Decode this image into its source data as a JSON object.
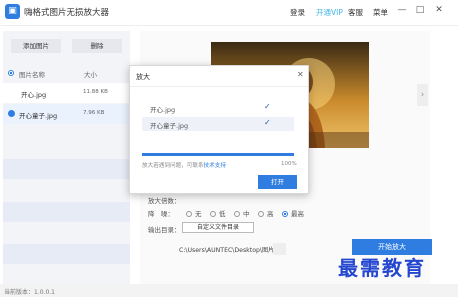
{
  "app": {
    "title": "嗨格式图片无损放大器",
    "logo_glyph": "▣"
  },
  "header": {
    "login": "登录",
    "vip": "开通VIP",
    "service": "客服",
    "menu": "菜单",
    "vip_color": "#3fb5e8"
  },
  "window": {
    "minimize": "—",
    "maximize": "□",
    "close": "✕"
  },
  "sidebar": {
    "add_button": "添加图片",
    "delete_button": "删除",
    "col_name": "图片名称",
    "col_size": "大小",
    "files": [
      {
        "name": "开心.jpg",
        "size": "11.88 KB",
        "selected": false
      },
      {
        "name": "开心童子.jpg",
        "size": "7.96 KB",
        "selected": true
      }
    ]
  },
  "settings": {
    "scale_label": "放大倍数：",
    "denoise_label": "降　噪：",
    "denoise_options": [
      "无",
      "低",
      "中",
      "高",
      "最高"
    ],
    "denoise_selected": "最高",
    "output_label": "输出目录：",
    "custom_dir_button": "自定义文件目录",
    "output_path": "C:\\Users\\AUNTEC\\Desktop\\图片\\",
    "start_button": "开始放大"
  },
  "dialog": {
    "title": "放大",
    "close": "✕",
    "items": [
      {
        "label": "开心.jpg",
        "done": true
      },
      {
        "label": "开心童子.jpg",
        "done": true
      }
    ],
    "progress_percent": 100,
    "progress_text": "100%",
    "hint_prefix": "放大若遇到问题，可联系",
    "hint_link": "技术支持",
    "open_button": "打开",
    "accent_color": "#2f7de1"
  },
  "status": {
    "version": "当前版本：1.0.0.1"
  },
  "watermark": {
    "text": "最需教育"
  },
  "icons": {
    "check": "✓",
    "arrow_right": "›"
  }
}
